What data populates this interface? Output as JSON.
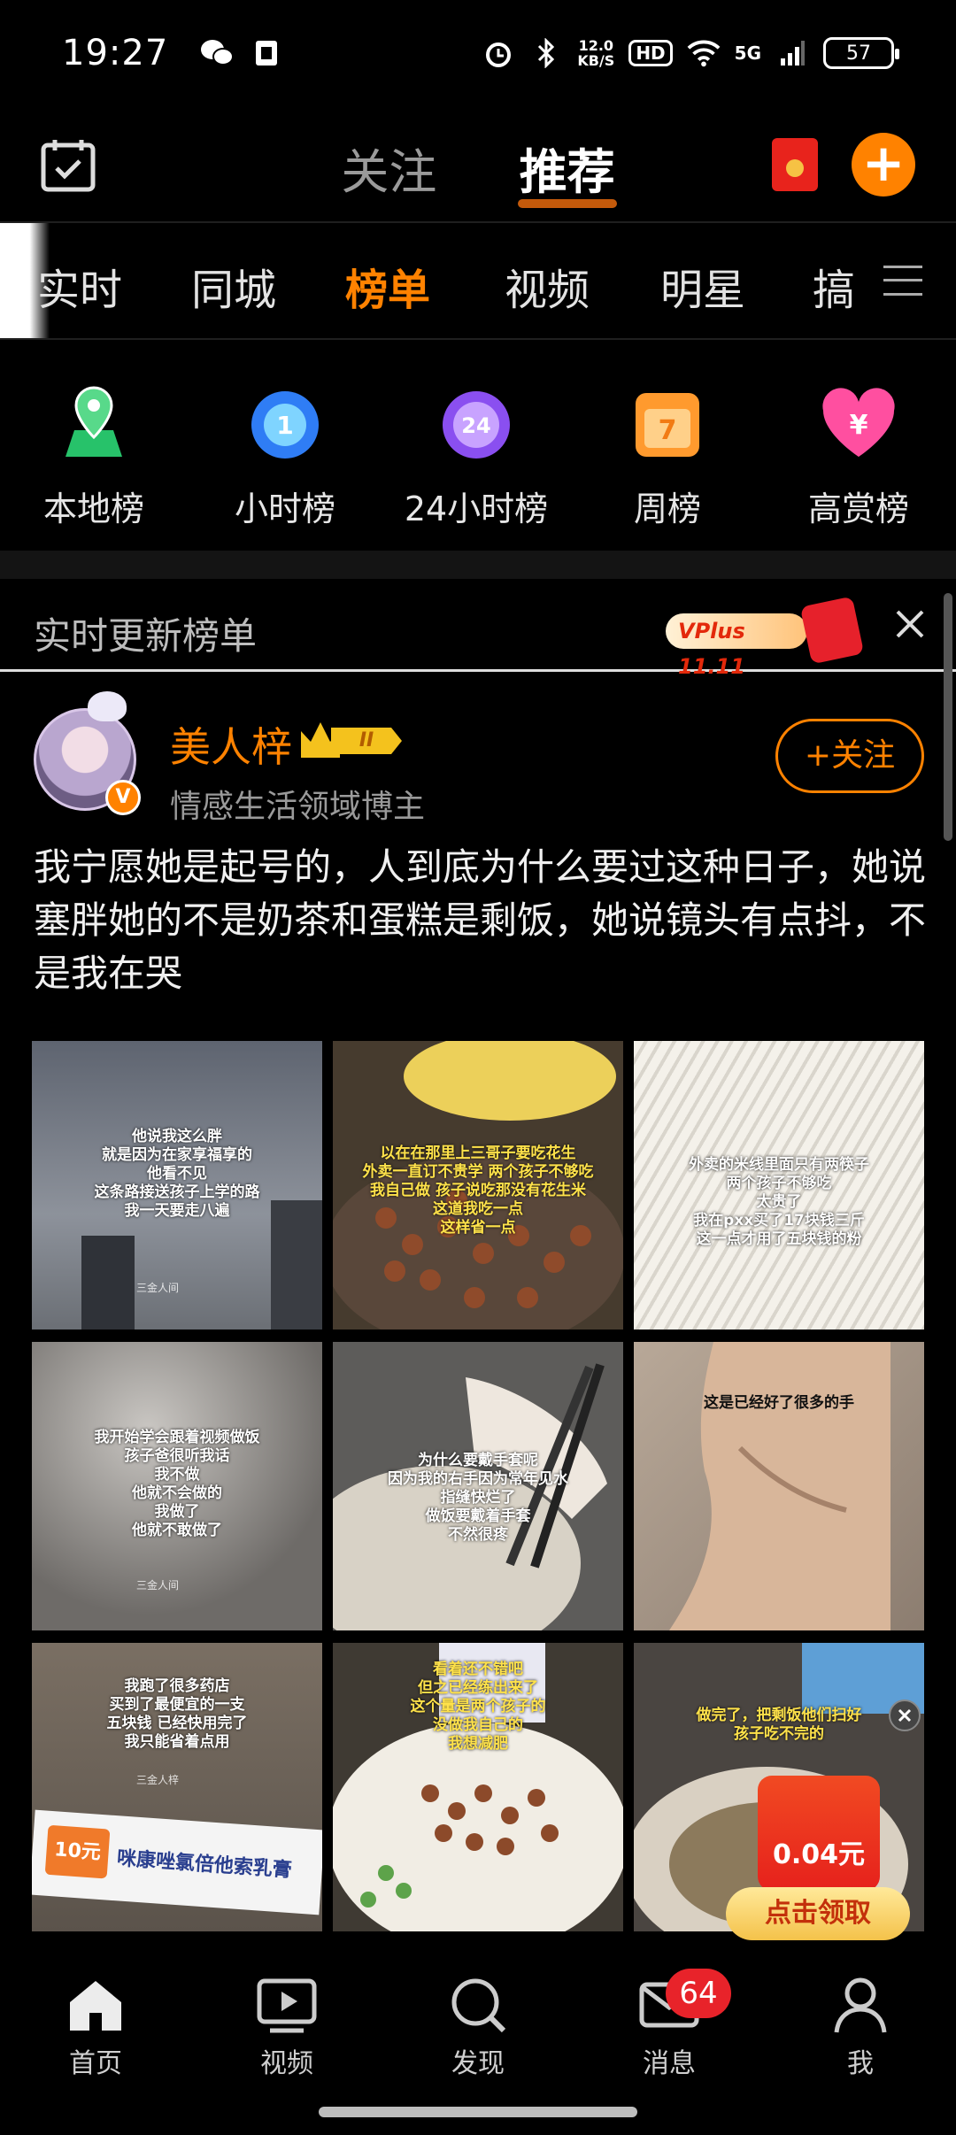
{
  "status_bar": {
    "time": "19:27",
    "net_speed_value": "12.0",
    "net_speed_unit": "KB/S",
    "hd_label": "HD",
    "network": "5G",
    "battery": "57"
  },
  "header": {
    "tabs": [
      {
        "label": "关注",
        "active": false
      },
      {
        "label": "推荐",
        "active": true
      }
    ],
    "plus_label": "+"
  },
  "categories": [
    {
      "label": "实时",
      "active": false
    },
    {
      "label": "同城",
      "active": false
    },
    {
      "label": "榜单",
      "active": true
    },
    {
      "label": "视频",
      "active": false
    },
    {
      "label": "明星",
      "active": false
    },
    {
      "label": "搞",
      "active": false
    }
  ],
  "ranks": [
    {
      "label": "本地榜",
      "icon": "location-pin-icon"
    },
    {
      "label": "小时榜",
      "icon": "hour-clock-icon",
      "glyph": "1"
    },
    {
      "label": "24小时榜",
      "icon": "24-hour-clock-icon",
      "glyph": "24"
    },
    {
      "label": "周榜",
      "icon": "calendar-icon",
      "glyph": "7"
    },
    {
      "label": "高赏榜",
      "icon": "heart-yen-icon",
      "glyph": "¥"
    }
  ],
  "realtime_bar": {
    "title": "实时更新榜单",
    "promo_text": "VPlus 11.11"
  },
  "post": {
    "username": "美人梓",
    "level": "II",
    "verified_mark": "V",
    "subtitle": "情感生活领域博主",
    "follow_label": "+关注",
    "text": "我宁愿她是起号的，人到底为什么要过这种日子，她说塞胖她的不是奶茶和蛋糕是剩饭，她说镜头有点抖，不是我在哭",
    "images": [
      {
        "caption": "他说我这么胖\n就是因为在家享福享的\n他看不见\n这条路接送孩子上学的路\n我一天要走八遍",
        "style": "sky",
        "watermark": "三金人间"
      },
      {
        "caption": "以在在那里上三哥子要吃花生\n外卖一直订不贵学 两个孩子不够吃\n我自己做 孩子说吃那没有花生米\n这道我吃一点\n这样省一点",
        "style": "peanuts",
        "yellow": true,
        "watermark": ""
      },
      {
        "caption": "外卖的米线里面只有两筷子\n两个孩子不够吃\n太贵了\n我在pxx买了17块钱三斤\n这一点才用了五块钱的粉",
        "style": "noodles",
        "watermark": ""
      },
      {
        "caption": "我开始学会跟着视频做饭\n孩子爸很听我话\n我不做\n他就不会做的\n我做了\n他就不敢做了",
        "style": "cloud",
        "watermark": "三金人间"
      },
      {
        "caption": "为什么要戴手套呢\n因为我的右手因为常年见水\n指缝快烂了\n做饭要戴着手套\n不然很疼",
        "style": "gloves",
        "watermark": ""
      },
      {
        "caption": "这是已经好了很多的手",
        "style": "hand",
        "watermark": ""
      },
      {
        "caption": "我跑了很多药店\n买到了最便宜的一支\n五块钱 已经快用完了\n我只能省着点用",
        "style": "ointment",
        "watermark": "三金人梓",
        "tube_label": "咪康唑氯倍他索乳膏",
        "tube_price": "10元"
      },
      {
        "caption": "看着还不错吧\n但之已经练出来了\n这个量是两个孩子的\n没做我自己的\n我想减肥",
        "style": "bowl",
        "yellow": true,
        "watermark": ""
      },
      {
        "caption": "做完了，把剩饭他们扫好\n孩子吃不完的",
        "style": "leftover",
        "yellow": true,
        "watermark": ""
      }
    ]
  },
  "floating_red_packet": {
    "amount": "0.04元",
    "cta": "点击领取"
  },
  "bottom_nav": [
    {
      "label": "首页",
      "icon": "home-icon",
      "active": true
    },
    {
      "label": "视频",
      "icon": "video-icon",
      "active": false
    },
    {
      "label": "发现",
      "icon": "search-icon",
      "active": false
    },
    {
      "label": "消息",
      "icon": "mail-icon",
      "active": false,
      "badge": "64"
    },
    {
      "label": "我",
      "icon": "profile-icon",
      "active": false
    }
  ]
}
